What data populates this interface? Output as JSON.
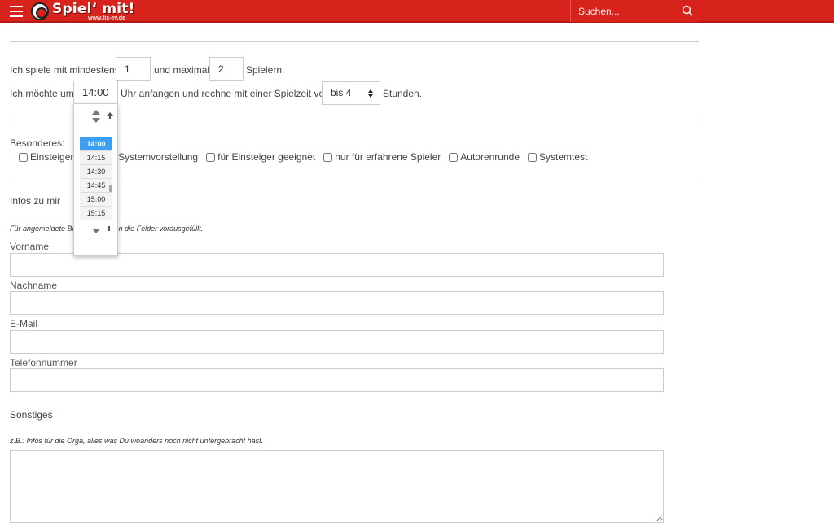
{
  "header": {
    "logo_title": "Spiel‘ mit!",
    "logo_sub": "www.fis-ev.de",
    "search_placeholder": "Suchen...",
    "colors": {
      "brand_red": "#d7231c"
    }
  },
  "players": {
    "prefix": "Ich spiele mit mindestens",
    "min_value": "1",
    "middle": "und maximal",
    "max_value": "2",
    "suffix": "Spielern."
  },
  "time": {
    "prefix": "Ich möchte um",
    "start_value": "14:00",
    "middle": "Uhr anfangen und rechne mit einer Spielzeit von",
    "duration_value": "bis 4",
    "suffix": "Stunden."
  },
  "picker": {
    "times": [
      "14:00",
      "14:15",
      "14:30",
      "14:45",
      "15:00",
      "15:15"
    ],
    "selected": "14:00"
  },
  "besonderes": {
    "label": "Besonderes:",
    "options": [
      "Einsteigerrunde",
      "Systemvorstellung",
      "für Einsteiger geeignet",
      "nur für erfahrene Spieler",
      "Autorenrunde",
      "Systemtest"
    ]
  },
  "infos": {
    "heading": "Infos zu mir",
    "note": "Für angemeldete Benutzer werden die Felder vorausgefüllt.",
    "fields": {
      "vorname": "Vorname",
      "nachname": "Nachname",
      "email": "E-Mail",
      "telefon": "Telefonnummer"
    }
  },
  "sonstiges": {
    "heading": "Sonstiges",
    "note": "z.B.: Infos für die Orga, alles was Du woanders noch nicht untergebracht hast."
  }
}
